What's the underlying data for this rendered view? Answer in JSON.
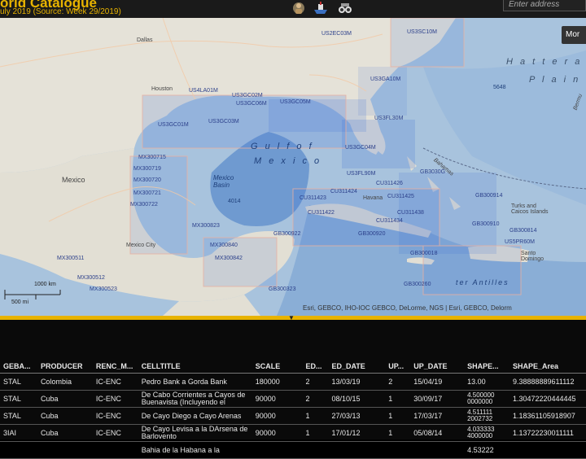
{
  "header": {
    "title": "orld Catalogue",
    "subtitle": "uly 2019 (Source: Week 29/2019)",
    "search_placeholder": "Enter address",
    "more_label": "Mor"
  },
  "map": {
    "sea_labels": [
      "G u l f   o f",
      "M e x i c o"
    ],
    "place_labels": {
      "dallas": "Dallas",
      "houston": "Houston",
      "mexico": "Mexico",
      "mexico_basin": "Mexico\nBasin",
      "depth_4014": "4014",
      "depth_5648": "5648",
      "mexico_city": "Mexico City",
      "hatteras": "H a t t e r a s",
      "plain": "P l a i n",
      "bahamas": "Bahamas",
      "bermuda": "Bermu",
      "turks": "Turks and\nCaicos Islands",
      "antilles": "ter Antilles",
      "havana": "Havana",
      "santo": "Santo\nDomingo"
    },
    "cell_labels": [
      "US3SC10M",
      "US3GA10M",
      "US2EC03M",
      "US3GC05M",
      "US3GC06M",
      "US4LA01M",
      "US3GC02M",
      "US3GC03M",
      "US3GC01M",
      "US3FL30M",
      "US3GC04M",
      "US3FL90M",
      "CU311426",
      "CU311425",
      "CU311424",
      "CU311422",
      "CU311423",
      "CU311434",
      "CU311438",
      "MX300715",
      "MX300719",
      "MX300720",
      "MX300721",
      "MX300722",
      "MX300823",
      "MX300840",
      "MX300842",
      "MX300511",
      "MX300512",
      "MX300523",
      "GB300922",
      "GB300323",
      "GB300910",
      "GB300914",
      "GB300920",
      "GB300260",
      "GB300018",
      "GB3030G",
      "US5PR60M",
      "GB300814"
    ],
    "scale_km": "1000 km",
    "scale_mi": "500 mi",
    "attribution": "Esri, GEBCO, IHO-IOC GEBCO, DeLorme, NGS | Esri, GEBCO, Delorm"
  },
  "table": {
    "columns": [
      "GEBA...",
      "PRODUCER",
      "RENC_M...",
      "CELLTITLE",
      "SCALE",
      "ED...",
      "ED_DATE",
      "UP...",
      "UP_DATE",
      "SHAPE...",
      "SHAPE_Area"
    ],
    "rows": [
      [
        "STAL",
        "Colombia",
        "IC-ENC",
        "Pedro Bank a Gorda Bank",
        "180000",
        "2",
        "13/03/19",
        "2",
        "15/04/19",
        "13.00",
        "9.38888889611112"
      ],
      [
        "STAL",
        "Cuba",
        "IC-ENC",
        "De Cabo Corrientes a Cayos de Buenavista (Incluyendo el",
        "90000",
        "2",
        "08/10/15",
        "1",
        "30/09/17",
        "4.500000\n0000000",
        "1.30472220444445"
      ],
      [
        "STAL",
        "Cuba",
        "IC-ENC",
        "De Cayo Diego a Cayo Arenas",
        "90000",
        "1",
        "27/03/13",
        "1",
        "17/03/17",
        "4.511111\n2002732",
        "1.18361105918907"
      ],
      [
        "3IAI",
        "Cuba",
        "IC-ENC",
        "De Cayo Levisa a la DArsena de Barlovento",
        "90000",
        "1",
        "17/01/12",
        "1",
        "05/08/14",
        "4.033333\n4000000",
        "1.13722230011111"
      ],
      [
        "",
        "",
        "",
        "Bahia de la Habana a la",
        "",
        "",
        "",
        "",
        "",
        "4.53222",
        ""
      ]
    ]
  },
  "colors": {
    "accent": "#e8b300",
    "ocean": "#a8c3dd",
    "enc_cell": "#3d6fd6",
    "land": "#e5e2d8"
  }
}
